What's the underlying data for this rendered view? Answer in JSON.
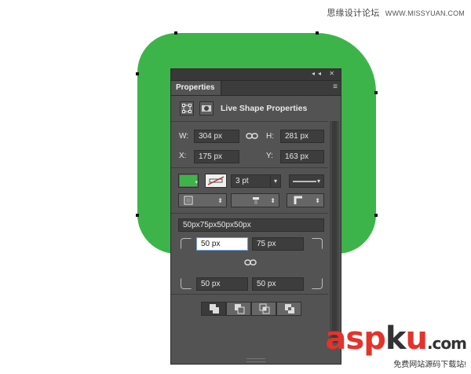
{
  "watermarks": {
    "top_text": "思缘设计论坛",
    "top_url": "WWW.MISSYUAN.COM",
    "bottom_brand_a": "asp",
    "bottom_brand_k": "k",
    "bottom_brand_u": "u",
    "bottom_brand_suffix": ".com",
    "bottom_caption": "免费网站源码下载站!"
  },
  "canvas": {
    "shape_fill": "#3db44a",
    "anchor_color": "#111111"
  },
  "panel": {
    "title_buttons": "◂◂ ✕",
    "tab_label": "Properties",
    "menu_icon": "≡",
    "header": {
      "title": "Live Shape Properties",
      "icons": [
        "bounding-box-icon",
        "mask-icon"
      ]
    },
    "dimensions": {
      "w_label": "W:",
      "w_value": "304 px",
      "h_label": "H:",
      "h_value": "281 px",
      "x_label": "X:",
      "x_value": "175 px",
      "y_label": "Y:",
      "y_value": "163 px",
      "link_icon": "chain-link-icon"
    },
    "appearance": {
      "fill_color": "#3db44a",
      "stroke_width": "3 pt",
      "stroke_type_icon": "line-style-icon"
    },
    "align": {
      "buttons": [
        "stroke-align-icon",
        "stroke-caps-icon",
        "stroke-corners-icon"
      ]
    },
    "corners": {
      "summary": "50px75px50px50px",
      "top_left": "50 px",
      "top_right": "75 px",
      "bottom_left": "50 px",
      "bottom_right": "50 px",
      "link_icon": "chain-link-icon"
    },
    "path_ops": [
      "combine-shapes-icon",
      "subtract-front-icon",
      "intersect-shapes-icon",
      "exclude-overlap-icon"
    ]
  }
}
